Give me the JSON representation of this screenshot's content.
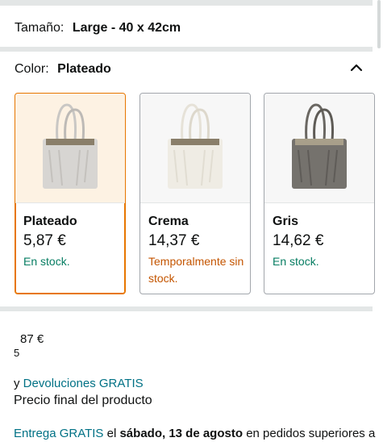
{
  "size": {
    "label": "Tamaño:",
    "value": "Large - 40 x 42cm"
  },
  "color": {
    "label": "Color:",
    "value": "Plateado",
    "toggle_icon": "chevron-up-icon"
  },
  "swatches": [
    {
      "name": "Plateado",
      "price": "5,87 €",
      "stock": "En stock.",
      "in_stock": true,
      "selected": true,
      "bag_color": "#d7d5d2"
    },
    {
      "name": "Crema",
      "price": "14,37 €",
      "stock": "Temporalmente sin stock.",
      "in_stock": false,
      "selected": false,
      "bag_color": "#efece4"
    },
    {
      "name": "Gris",
      "price": "14,62 €",
      "stock": "En stock.",
      "in_stock": true,
      "selected": false,
      "bag_color": "#75726d"
    }
  ],
  "price_fragment": {
    "main": "87 €",
    "sub": "5"
  },
  "returns": {
    "prefix": "y",
    "link": "Devoluciones GRATIS"
  },
  "final_price_text": "Precio final del producto",
  "delivery": {
    "link": "Entrega GRATIS",
    "text1": "el",
    "date": "sábado, 13 de agosto",
    "text2": "en pedidos superiores a"
  },
  "colors": {
    "link": "#007185",
    "in_stock": "#067d62",
    "out_stock": "#c45500",
    "selected_border": "#e77600"
  }
}
